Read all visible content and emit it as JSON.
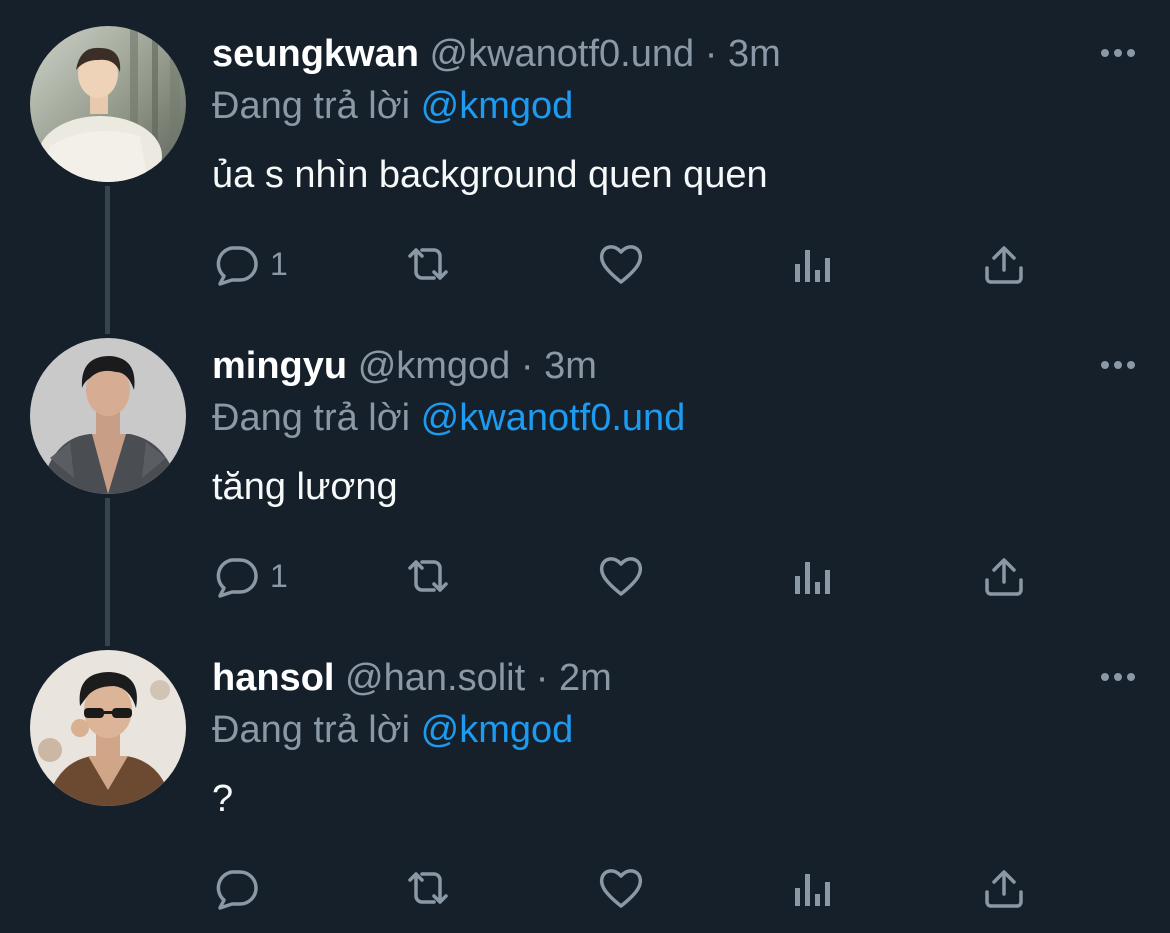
{
  "icons": {
    "reply": "reply-icon",
    "retweet": "retweet-icon",
    "like": "heart-icon",
    "views": "views-icon",
    "share": "share-icon",
    "more": "more-icon"
  },
  "colors": {
    "background": "#15202b",
    "secondary_text": "#8b98a5",
    "mention": "#1d9bf0",
    "thread_line": "#38444d"
  },
  "tweets": [
    {
      "name": "seungkwan",
      "handle": "@kwanotf0.und",
      "separator": "·",
      "time": "3m",
      "replying_label": "Đang trả lời",
      "replying_to": "@kmgod",
      "text": "ủa s nhìn background quen quen",
      "reply_count": "1"
    },
    {
      "name": "mingyu",
      "handle": "@kmgod",
      "separator": "·",
      "time": "3m",
      "replying_label": "Đang trả lời",
      "replying_to": "@kwanotf0.und",
      "text": "tăng lương",
      "reply_count": "1"
    },
    {
      "name": "hansol",
      "handle": "@han.solit",
      "separator": "·",
      "time": "2m",
      "replying_label": "Đang trả lời",
      "replying_to": "@kmgod",
      "text": "?",
      "reply_count": ""
    }
  ]
}
